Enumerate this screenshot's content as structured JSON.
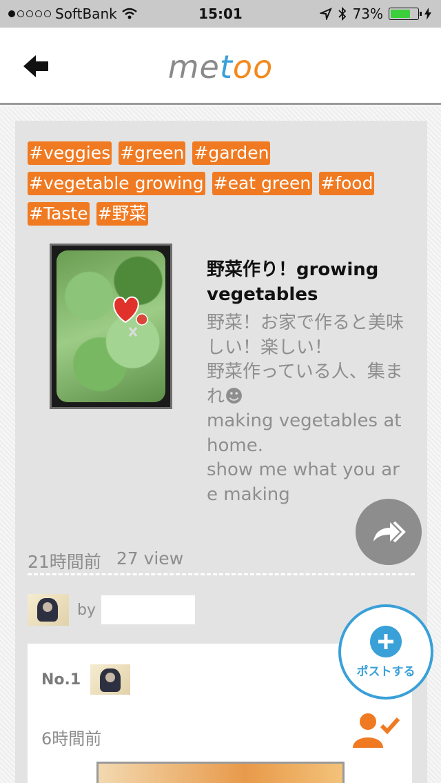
{
  "status_bar": {
    "carrier": "SoftBank",
    "time": "15:01",
    "battery": "73%",
    "battery_level": 0.73
  },
  "nav": {
    "logo_parts": [
      "me",
      "t",
      "o",
      "o"
    ]
  },
  "post": {
    "tags": [
      "#veggies",
      "#green",
      "#garden",
      "#vegetable growing",
      "#eat green",
      "#food",
      "#Taste",
      "#野菜"
    ],
    "title": "野菜作り！growing vegetables",
    "body": "野菜！お家で作ると美味しい！楽しい！\n野菜作っている人、集まれ☻\nmaking vegetables at home.\nshow me what you are making",
    "posted_ago": "21時間前",
    "views": "27 view",
    "by_label": "by"
  },
  "entry": {
    "rank": "No.1",
    "time_ago": "6時間前"
  },
  "fab": {
    "label": "ポストする"
  },
  "colors": {
    "accent_orange": "#f07a22",
    "accent_blue": "#3aa0d8"
  },
  "icons": [
    "back-arrow-icon",
    "share-forward-icon",
    "follow-user-icon",
    "plus-icon"
  ]
}
